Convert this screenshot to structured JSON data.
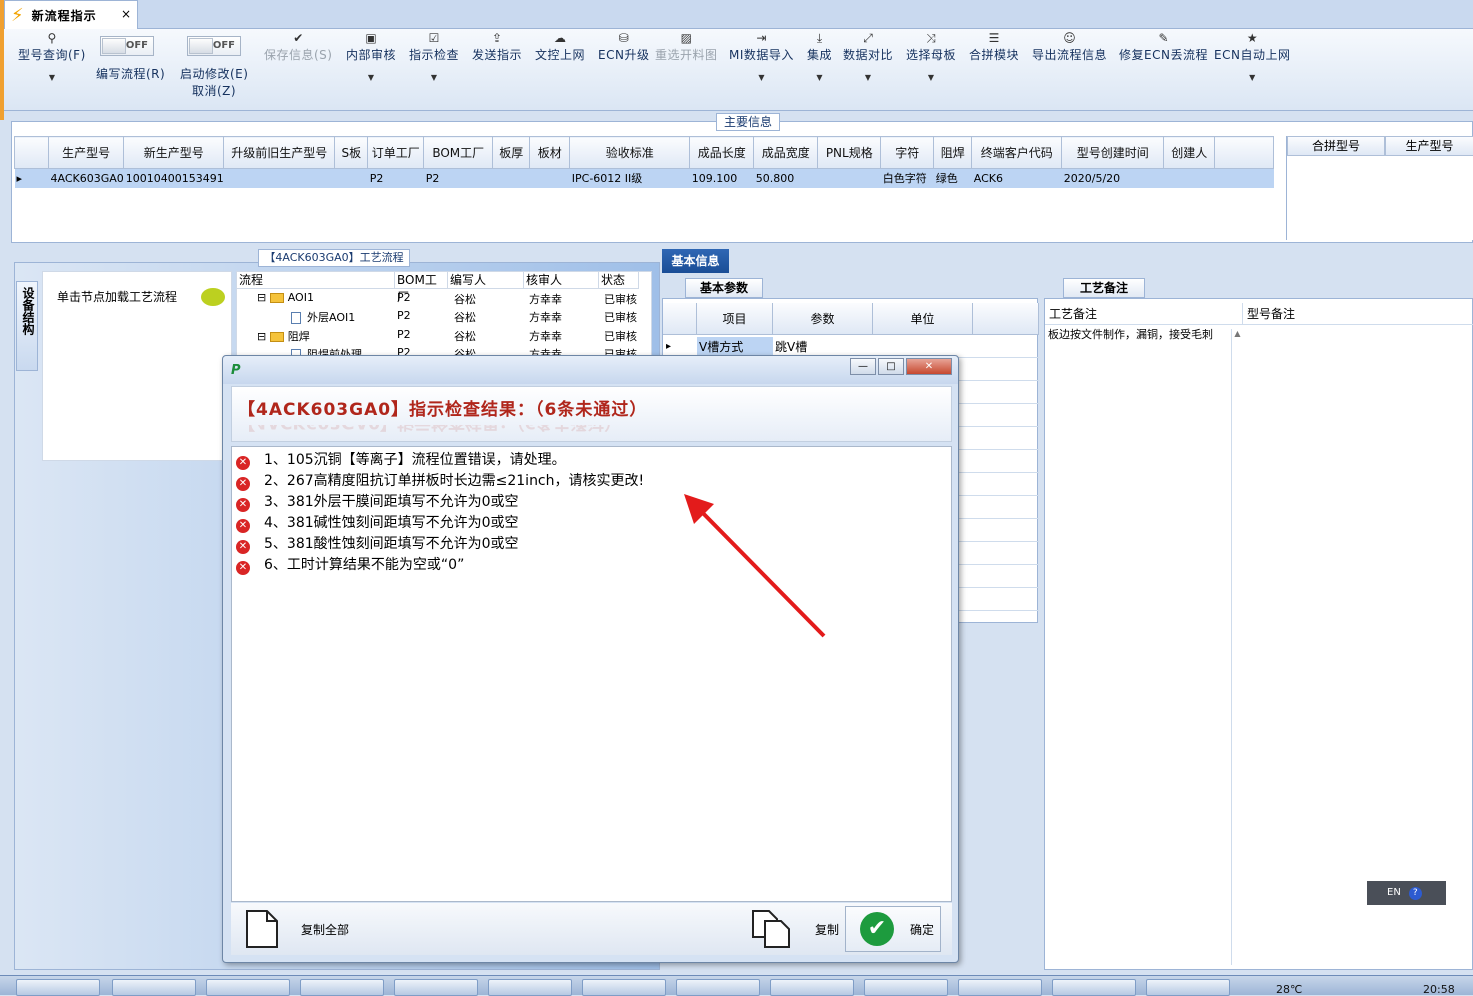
{
  "tab": {
    "title": "新流程指示",
    "close": "×"
  },
  "ribbon": {
    "buttons": [
      {
        "label": "型号查询(F)",
        "icon": "search-icon"
      },
      {
        "label": "保存信息(S)",
        "icon": "save-icon",
        "disabled": true
      },
      {
        "label": "内部审核",
        "icon": "printer-icon"
      },
      {
        "label": "指示检查",
        "icon": "checkbox-icon"
      },
      {
        "label": "发送指示",
        "icon": "upload-icon"
      },
      {
        "label": "文控上网",
        "icon": "cloud-upload-icon"
      },
      {
        "label": "ECN升级",
        "icon": "ecn-icon"
      },
      {
        "label": "重选开料图",
        "icon": "image-icon",
        "disabled": true
      },
      {
        "label": "MI数据导入",
        "icon": "import-icon"
      },
      {
        "label": "集成",
        "icon": "download-icon"
      },
      {
        "label": "数据对比",
        "icon": "compare-icon"
      },
      {
        "label": "选择母板",
        "icon": "shuffle-icon"
      },
      {
        "label": "合拼模块",
        "icon": "list-icon"
      },
      {
        "label": "导出流程信息",
        "icon": "smile-icon"
      },
      {
        "label": "修复ECN丢流程",
        "icon": "wrench-icon"
      },
      {
        "label": "ECN自动上网",
        "icon": "star-icon"
      }
    ],
    "toggles": [
      {
        "label": "编写流程(R)",
        "state": "OFF"
      },
      {
        "label": "启动修改(E)",
        "state": "OFF",
        "sub": "取消(Z)"
      }
    ]
  },
  "main_info": {
    "legend": "主要信息",
    "columns": [
      "生产型号",
      "新生产型号",
      "升级前旧生产型号",
      "S板",
      "订单工厂",
      "BOM工厂",
      "板厚",
      "板材",
      "验收标准",
      "成品长度",
      "成品宽度",
      "PNL规格",
      "字符",
      "阻焊",
      "终端客户代码",
      "型号创建时间",
      "创建人"
    ],
    "row": [
      "4ACK603GA0",
      "10010400153491",
      "",
      "",
      "P2",
      "P2",
      "",
      "",
      "IPC-6012 II级",
      "109.100",
      "50.800",
      "",
      "白色字符",
      "绿色",
      "ACK6",
      "2020/5/20",
      ""
    ],
    "right_columns": [
      "合拼型号",
      "生产型号"
    ]
  },
  "process": {
    "legend": "【4ACK603GA0】工艺流程",
    "vertical_tab": "设备结构",
    "node_hint": "单击节点加载工艺流程",
    "tree_headers": [
      "流程",
      "BOM工厂",
      "编写人",
      "核审人",
      "状态"
    ],
    "tree_rows": [
      {
        "name": "AOI1",
        "bom": "P2",
        "writer": "谷松",
        "reviewer": "方幸幸",
        "status": "已审核",
        "type": "folder"
      },
      {
        "name": "外层AOI1",
        "bom": "P2",
        "writer": "谷松",
        "reviewer": "方幸幸",
        "status": "已审核",
        "type": "doc"
      },
      {
        "name": "阻焊",
        "bom": "P2",
        "writer": "谷松",
        "reviewer": "方幸幸",
        "status": "已审核",
        "type": "folder"
      },
      {
        "name": "阻焊前处理",
        "bom": "P2",
        "writer": "谷松",
        "reviewer": "方幸幸",
        "status": "已审核",
        "type": "doc"
      }
    ]
  },
  "basic": {
    "tab": "基本信息",
    "subtab": "基本参数",
    "columns": [
      "项目",
      "参数",
      "单位"
    ],
    "rows": [
      {
        "item": "V槽方式",
        "param": "跳V槽",
        "unit": ""
      }
    ]
  },
  "craft": {
    "tab": "工艺备注",
    "columns": [
      "工艺备注",
      "型号备注"
    ],
    "note": "板边按文件制作，漏铜，接受毛刺"
  },
  "dialog": {
    "title": "【4ACK603GA0】指示检查结果：（6条未通过）",
    "errors": [
      "1、105沉铜【等离子】流程位置错误，请处理。",
      "2、267高精度阻抗订单拼板时长边需≤21inch，请核实更改!",
      "3、381外层干膜间距填写不允许为0或空",
      "4、381碱性蚀刻间距填写不允许为0或空",
      "5、381酸性蚀刻间距填写不允许为0或空",
      "6、工时计算结果不能为空或“0”"
    ],
    "copy_all": "复制全部",
    "copy": "复制",
    "ok": "确定"
  },
  "tray": {
    "lang": "EN",
    "temp": "28℃",
    "time": "20:58"
  },
  "colors": {
    "accent": "#1a4d96",
    "error": "#d92525",
    "title_red": "#b0261b",
    "arrow": "#e31b1b"
  }
}
